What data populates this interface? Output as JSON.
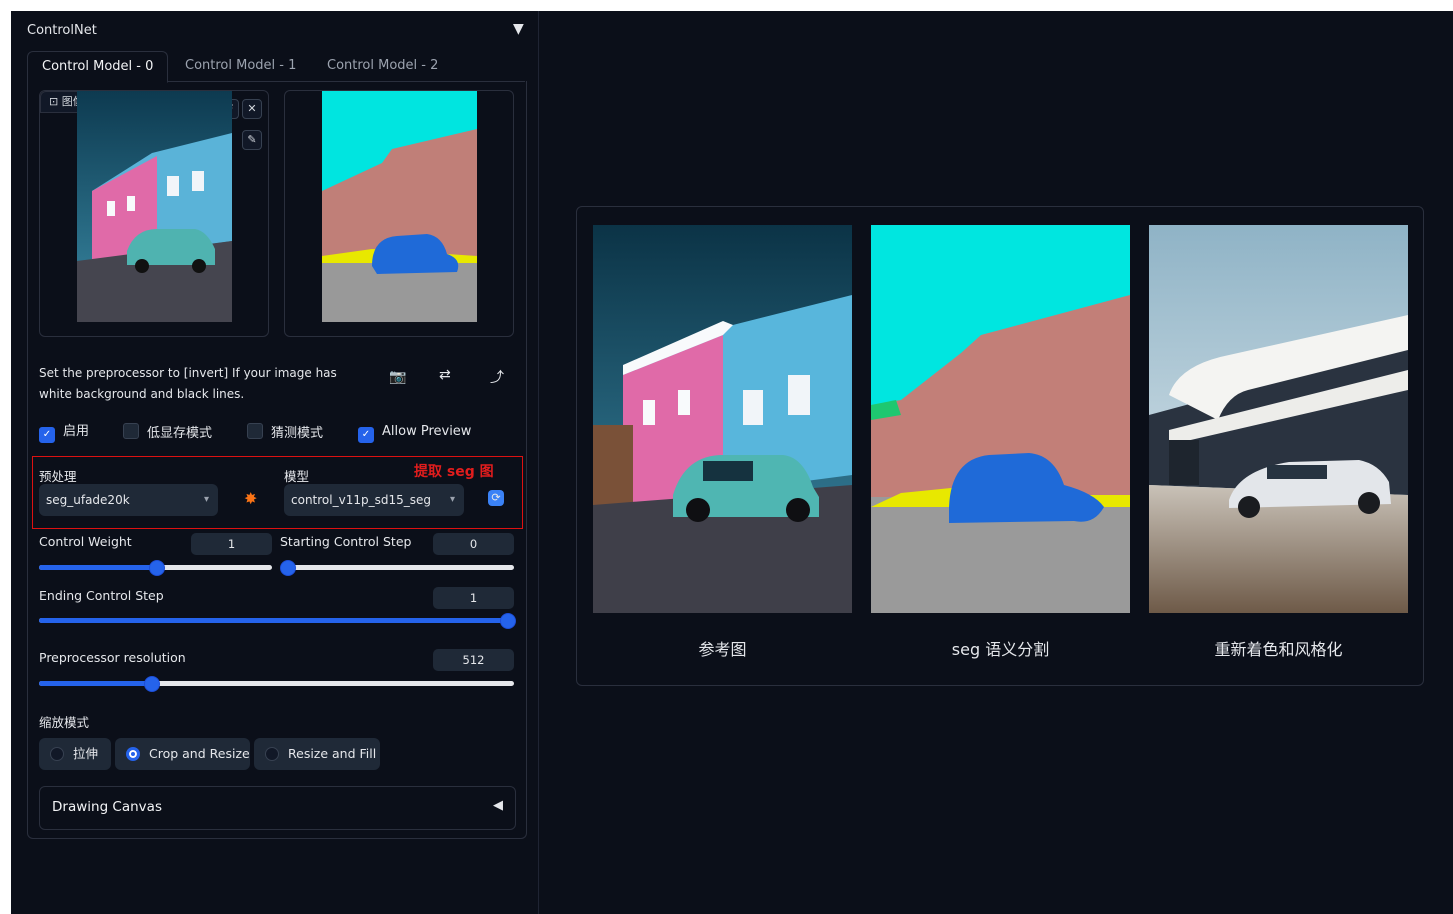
{
  "accordion": {
    "title": "ControlNet",
    "toggle": "▼"
  },
  "tabs": [
    "Control Model - 0",
    "Control Model - 1",
    "Control Model - 2"
  ],
  "image_input": {
    "label": "图像",
    "reset_icon": "↺",
    "close_icon": "✕",
    "edit_icon": "✎"
  },
  "note": "Set the preprocessor to [invert] If your image has white background and black lines.",
  "checkboxes": [
    {
      "label": "启用",
      "checked": true
    },
    {
      "label": "低显存模式",
      "checked": false
    },
    {
      "label": "猜测模式",
      "checked": false
    },
    {
      "label": "Allow Preview",
      "checked": true
    }
  ],
  "preprocessor": {
    "label": "预处理",
    "value": "seg_ufade20k"
  },
  "model": {
    "label": "模型",
    "value": "control_v11p_sd15_seg"
  },
  "annotation": "提取 seg 图",
  "control_weight": {
    "label": "Control Weight",
    "value": "1",
    "fraction": 0.5
  },
  "starting_step": {
    "label": "Starting Control Step",
    "value": "0",
    "fraction": 0.0
  },
  "ending_step": {
    "label": "Ending Control Step",
    "value": "1",
    "fraction": 1.0
  },
  "resolution": {
    "label": "Preprocessor resolution",
    "value": "512",
    "fraction": 0.235
  },
  "resize_mode": {
    "label": "缩放模式",
    "options": [
      "拉伸",
      "Crop and Resize",
      "Resize and Fill"
    ],
    "selected": "Crop and Resize"
  },
  "drawing_canvas": {
    "label": "Drawing Canvas",
    "arrow": "◀"
  },
  "gallery": {
    "captions": [
      "参考图",
      "seg 语义分割",
      "重新着色和风格化"
    ]
  },
  "colors": {
    "accent": "#2563eb",
    "background": "#0b0f19",
    "annotation": "#e11d1d"
  }
}
